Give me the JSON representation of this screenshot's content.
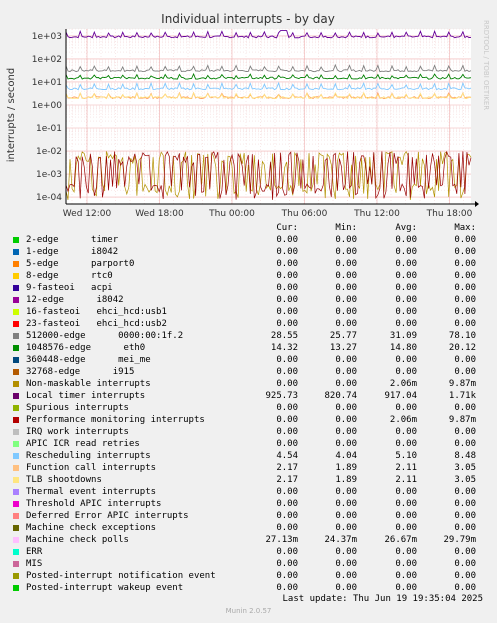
{
  "chart_data": {
    "type": "line",
    "title": "Individual interrupts - by day",
    "ylabel": "interrupts / second",
    "watermark": "RRDTOOL / TOBI OETIKER",
    "y_scale": "log",
    "ylim": [
      5e-05,
      2000
    ],
    "y_ticks": [
      "1e+03",
      "1e+02",
      "1e+01",
      "1e+00",
      "1e-01",
      "1e-02",
      "1e-03",
      "1e-04"
    ],
    "x_ticks": [
      "Wed 12:00",
      "Wed 18:00",
      "Thu 00:00",
      "Thu 06:00",
      "Thu 12:00",
      "Thu 18:00"
    ],
    "grid": true,
    "series_levels": [
      {
        "name": "Local timer interrupts",
        "color": "#660099",
        "typical": 917.04,
        "peak": 1710
      },
      {
        "name": "512000-edge",
        "color": "#808080",
        "typical": 31.09,
        "peak": 78.1
      },
      {
        "name": "1048576-edge",
        "color": "#007f00",
        "typical": 14.8,
        "peak": 20.12
      },
      {
        "name": "Rescheduling interrupts",
        "color": "#80c8ff",
        "typical": 5.1,
        "peak": 8.48
      },
      {
        "name": "Function call interrupts",
        "color": "#ffa060",
        "typical": 2.11,
        "peak": 3.05
      },
      {
        "name": "TLB shootdowns",
        "color": "#ffe080",
        "typical": 2.11,
        "peak": 3.05
      },
      {
        "name": "Non-maskable interrupts",
        "color": "#b39200",
        "typical": 0.00206,
        "peak": 0.00987
      },
      {
        "name": "Performance monitoring interrupts",
        "color": "#990000",
        "typical": 0.00206,
        "peak": 0.00987
      }
    ]
  },
  "legend": {
    "headers": [
      "Cur:",
      "Min:",
      "Avg:",
      "Max:"
    ],
    "rows": [
      {
        "name": "2-edge      timer",
        "color": "#00cc00",
        "cur": "0.00",
        "min": "0.00",
        "avg": "0.00",
        "max": "0.00"
      },
      {
        "name": "1-edge      i8042",
        "color": "#0066b3",
        "cur": "0.00",
        "min": "0.00",
        "avg": "0.00",
        "max": "0.00"
      },
      {
        "name": "5-edge      parport0",
        "color": "#ff8000",
        "cur": "0.00",
        "min": "0.00",
        "avg": "0.00",
        "max": "0.00"
      },
      {
        "name": "8-edge      rtc0",
        "color": "#ffcc00",
        "cur": "0.00",
        "min": "0.00",
        "avg": "0.00",
        "max": "0.00"
      },
      {
        "name": "9-fasteoi   acpi",
        "color": "#330099",
        "cur": "0.00",
        "min": "0.00",
        "avg": "0.00",
        "max": "0.00"
      },
      {
        "name": "12-edge      i8042",
        "color": "#990099",
        "cur": "0.00",
        "min": "0.00",
        "avg": "0.00",
        "max": "0.00"
      },
      {
        "name": "16-fasteoi   ehci_hcd:usb1",
        "color": "#ccff00",
        "cur": "0.00",
        "min": "0.00",
        "avg": "0.00",
        "max": "0.00"
      },
      {
        "name": "23-fasteoi   ehci_hcd:usb2",
        "color": "#ff0000",
        "cur": "0.00",
        "min": "0.00",
        "avg": "0.00",
        "max": "0.00"
      },
      {
        "name": "512000-edge      0000:00:1f.2",
        "color": "#808080",
        "cur": "28.55",
        "min": "25.77",
        "avg": "31.09",
        "max": "78.10"
      },
      {
        "name": "1048576-edge      eth0",
        "color": "#008f00",
        "cur": "14.32",
        "min": "13.27",
        "avg": "14.80",
        "max": "20.12"
      },
      {
        "name": "360448-edge      mei_me",
        "color": "#00487d",
        "cur": "0.00",
        "min": "0.00",
        "avg": "0.00",
        "max": "0.00"
      },
      {
        "name": "32768-edge      i915",
        "color": "#b35a00",
        "cur": "0.00",
        "min": "0.00",
        "avg": "0.00",
        "max": "0.00"
      },
      {
        "name": "Non-maskable interrupts",
        "color": "#b38f00",
        "cur": "0.00",
        "min": "0.00",
        "avg": "2.06m",
        "max": "9.87m"
      },
      {
        "name": "Local timer interrupts",
        "color": "#6b006b",
        "cur": "925.73",
        "min": "820.74",
        "avg": "917.04",
        "max": "1.71k"
      },
      {
        "name": "Spurious interrupts",
        "color": "#8fb300",
        "cur": "0.00",
        "min": "0.00",
        "avg": "0.00",
        "max": "0.00"
      },
      {
        "name": "Performance monitoring interrupts",
        "color": "#b30000",
        "cur": "0.00",
        "min": "0.00",
        "avg": "2.06m",
        "max": "9.87m"
      },
      {
        "name": "IRQ work interrupts",
        "color": "#bebebe",
        "cur": "0.00",
        "min": "0.00",
        "avg": "0.00",
        "max": "0.00"
      },
      {
        "name": "APIC ICR read retries",
        "color": "#80ff80",
        "cur": "0.00",
        "min": "0.00",
        "avg": "0.00",
        "max": "0.00"
      },
      {
        "name": "Rescheduling interrupts",
        "color": "#80c9ff",
        "cur": "4.54",
        "min": "4.04",
        "avg": "5.10",
        "max": "8.48"
      },
      {
        "name": "Function call interrupts",
        "color": "#ffc080",
        "cur": "2.17",
        "min": "1.89",
        "avg": "2.11",
        "max": "3.05"
      },
      {
        "name": "TLB shootdowns",
        "color": "#ffe680",
        "cur": "2.17",
        "min": "1.89",
        "avg": "2.11",
        "max": "3.05"
      },
      {
        "name": "Thermal event interrupts",
        "color": "#aa80ff",
        "cur": "0.00",
        "min": "0.00",
        "avg": "0.00",
        "max": "0.00"
      },
      {
        "name": "Threshold APIC interrupts",
        "color": "#ee00cc",
        "cur": "0.00",
        "min": "0.00",
        "avg": "0.00",
        "max": "0.00"
      },
      {
        "name": "Deferred Error APIC interrupts",
        "color": "#ff8080",
        "cur": "0.00",
        "min": "0.00",
        "avg": "0.00",
        "max": "0.00"
      },
      {
        "name": "Machine check exceptions",
        "color": "#666600",
        "cur": "0.00",
        "min": "0.00",
        "avg": "0.00",
        "max": "0.00"
      },
      {
        "name": "Machine check polls",
        "color": "#ffbfff",
        "cur": "27.13m",
        "min": "24.37m",
        "avg": "26.67m",
        "max": "29.79m"
      },
      {
        "name": "ERR",
        "color": "#00ffcc",
        "cur": "0.00",
        "min": "0.00",
        "avg": "0.00",
        "max": "0.00"
      },
      {
        "name": "MIS",
        "color": "#cc6699",
        "cur": "0.00",
        "min": "0.00",
        "avg": "0.00",
        "max": "0.00"
      },
      {
        "name": "Posted-interrupt notification event",
        "color": "#999900",
        "cur": "0.00",
        "min": "0.00",
        "avg": "0.00",
        "max": "0.00"
      },
      {
        "name": "Posted-interrupt wakeup event",
        "color": "#00cc00",
        "cur": "0.00",
        "min": "0.00",
        "avg": "0.00",
        "max": "0.00"
      }
    ]
  },
  "footer": {
    "last_update": "Last update: Thu Jun 19 19:35:04 2025",
    "munin": "Munin 2.0.57"
  }
}
